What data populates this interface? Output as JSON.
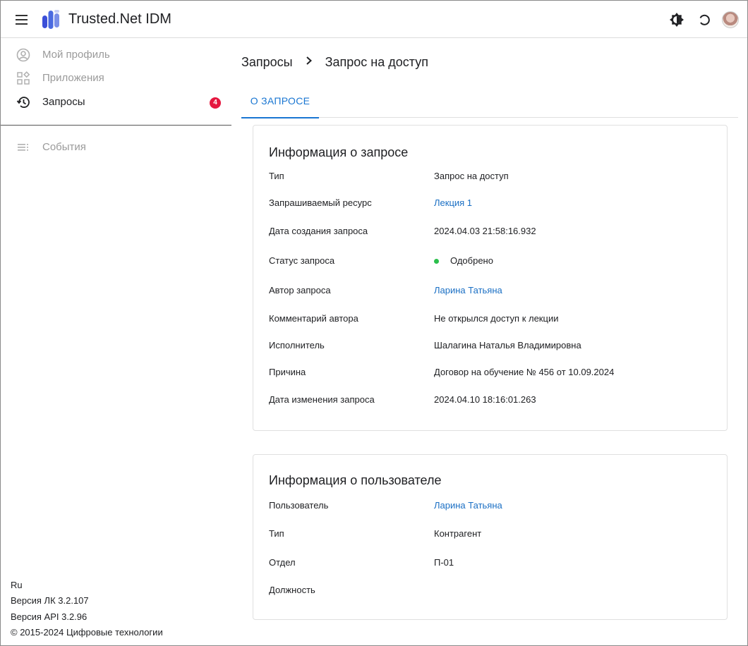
{
  "header": {
    "app_title": "Trusted.Net IDM",
    "icons": [
      "menu-icon",
      "logo-icon",
      "theme-icon",
      "refresh-icon",
      "avatar"
    ]
  },
  "sidebar": {
    "items": [
      {
        "label": "Мой профиль",
        "icon": "user-circle-icon",
        "state": "disabled"
      },
      {
        "label": "Приложения",
        "icon": "apps-icon",
        "state": "disabled"
      },
      {
        "label": "Запросы",
        "icon": "history-icon",
        "state": "active",
        "badge": "4"
      },
      {
        "label": "События",
        "icon": "list-icon",
        "state": "disabled"
      }
    ],
    "footer": {
      "language": "Ru",
      "version_lk": "Версия ЛК 3.2.107",
      "version_api": "Версия API 3.2.96",
      "copyright": "© 2015-2024 Цифровые технологии"
    }
  },
  "breadcrumb": {
    "parent": "Запросы",
    "current": "Запрос на доступ"
  },
  "tabs": [
    {
      "label": "О ЗАПРОСЕ",
      "active": true
    }
  ],
  "request_card": {
    "title": "Информация о запросе",
    "rows": [
      {
        "key": "Тип",
        "value": "Запрос на доступ"
      },
      {
        "key": "Запрашиваемый ресурс",
        "value": "Лекция 1"
      },
      {
        "key": "Дата создания запроса",
        "value": "2024.04.03 21:58:16.932"
      },
      {
        "key": "Статус запроса",
        "value": "Одобрено"
      },
      {
        "key": "Автор запроса",
        "value": "Ларина Татьяна"
      },
      {
        "key": "Комментарий автора",
        "value": "Не открылся доступ к лекции"
      },
      {
        "key": "Исполнитель",
        "value": "Шалагина Наталья Владимировна"
      },
      {
        "key": "Причина",
        "value": "Договор на обучение № 456 от 10.09.2024"
      },
      {
        "key": "Дата изменения запроса",
        "value": "2024.04.10 18:16:01.263"
      }
    ]
  },
  "user_card": {
    "title": "Информация о пользователе",
    "rows": [
      {
        "key": "Пользователь",
        "value": "Ларина Татьяна"
      },
      {
        "key": "Тип",
        "value": "Контрагент"
      },
      {
        "key": "Отдел",
        "value": "П-01"
      },
      {
        "key": "Должность",
        "value": ""
      }
    ]
  },
  "colors": {
    "accent": "#1976d2",
    "link": "#1a6fc4",
    "badge": "#e5173f",
    "status_approved": "#2bbf4c"
  }
}
